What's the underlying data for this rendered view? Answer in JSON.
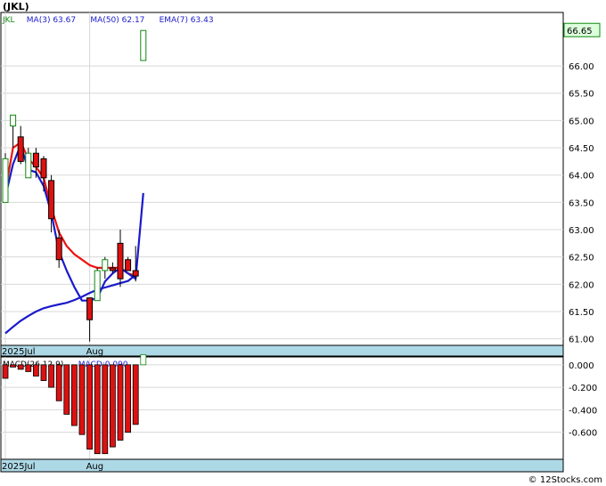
{
  "ticker": "(JKL)",
  "footer": "© 12Stocks.com",
  "colors": {
    "ma_fast": "#ee1111",
    "ma_slow": "#1a1acc",
    "up_candle": "#118811",
    "down_candle": "#dd1111",
    "date_band": "#add8e6",
    "last_price_bg": "#ddffdd"
  },
  "chart_data": [
    {
      "type": "candlestick",
      "legend": [
        {
          "label": "JKL",
          "color": "#118811"
        },
        {
          "label": "MA(3)",
          "value": "63.67",
          "color": "#1a1acc"
        },
        {
          "label": "MA(50)",
          "value": "62.17",
          "color": "#1a1acc"
        },
        {
          "label": "EMA(7)",
          "value": "63.43",
          "color": "#1a1acc"
        }
      ],
      "last_price": "66.65",
      "ylim": [
        60.88,
        66.98
      ],
      "y_ticks": [
        61.0,
        61.5,
        62.0,
        62.5,
        63.0,
        63.5,
        64.0,
        64.5,
        65.0,
        65.5,
        66.0
      ],
      "x_labels": [
        {
          "label": "2025Jul",
          "index": 0
        },
        {
          "label": "Aug",
          "index": 11
        }
      ],
      "candles": [
        {
          "o": 63.5,
          "h": 64.4,
          "l": 63.5,
          "c": 64.3
        },
        {
          "o": 64.9,
          "h": 65.1,
          "l": 64.5,
          "c": 65.1
        },
        {
          "o": 64.7,
          "h": 64.9,
          "l": 64.2,
          "c": 64.25
        },
        {
          "o": 63.95,
          "h": 64.5,
          "l": 63.95,
          "c": 64.4
        },
        {
          "o": 64.4,
          "h": 64.5,
          "l": 63.95,
          "c": 64.15
        },
        {
          "o": 64.3,
          "h": 64.35,
          "l": 63.7,
          "c": 63.95
        },
        {
          "o": 63.9,
          "h": 64.0,
          "l": 62.95,
          "c": 63.2
        },
        {
          "o": 62.85,
          "h": 63.0,
          "l": 62.3,
          "c": 62.45
        },
        {
          "o": null,
          "h": null,
          "l": null,
          "c": null
        },
        {
          "o": null,
          "h": null,
          "l": null,
          "c": null
        },
        {
          "o": null,
          "h": null,
          "l": null,
          "c": null
        },
        {
          "o": 61.75,
          "h": 61.75,
          "l": 60.95,
          "c": 61.35
        },
        {
          "o": 61.7,
          "h": 62.3,
          "l": 61.7,
          "c": 62.25
        },
        {
          "o": 62.25,
          "h": 62.5,
          "l": 62.1,
          "c": 62.45
        },
        {
          "o": 62.3,
          "h": 62.4,
          "l": 62.2,
          "c": 62.25
        },
        {
          "o": 62.75,
          "h": 63.0,
          "l": 61.95,
          "c": 62.1
        },
        {
          "o": 62.45,
          "h": 62.5,
          "l": 62.25,
          "c": 62.25
        },
        {
          "o": 62.25,
          "h": 62.7,
          "l": 62.05,
          "c": 62.15
        },
        {
          "o": 66.1,
          "h": 66.6,
          "l": 66.1,
          "c": 66.65
        }
      ],
      "ema_line": [
        63.7,
        64.5,
        64.6,
        64.3,
        64.15,
        63.95,
        63.4,
        62.95,
        62.7,
        62.55,
        62.45,
        62.35,
        62.3,
        62.3,
        62.3,
        62.3,
        62.2,
        62.15,
        null
      ],
      "ma_short_line": [
        63.6,
        64.2,
        64.55,
        64.1,
        64.05,
        63.8,
        63.3,
        62.6,
        62.25,
        61.95,
        61.7,
        61.7,
        61.75,
        62.05,
        62.2,
        62.3,
        62.2,
        62.1,
        63.67
      ],
      "ma_long_line": [
        61.1,
        61.22,
        61.33,
        61.42,
        61.5,
        61.56,
        61.6,
        61.63,
        61.66,
        61.71,
        61.77,
        61.84,
        61.9,
        61.94,
        61.98,
        62.02,
        62.06,
        62.17,
        null
      ]
    },
    {
      "type": "bar",
      "legend": [
        {
          "label": "MACD(26,12,9)",
          "color": "#000000"
        },
        {
          "label": "MACD:0.090",
          "color": "#1a1acc"
        }
      ],
      "ylim": [
        -0.84,
        0.07
      ],
      "y_ticks": [
        0.0,
        -0.2,
        -0.4,
        -0.6
      ],
      "y_tick_labels": [
        "0.000",
        "-0.200",
        "-0.400",
        "-0.600"
      ],
      "x_labels": [
        {
          "label": "2025Jul",
          "index": 0
        },
        {
          "label": "Aug",
          "index": 11
        }
      ],
      "values": [
        -0.12,
        -0.02,
        -0.04,
        -0.06,
        -0.1,
        -0.14,
        -0.2,
        -0.32,
        -0.44,
        -0.54,
        -0.62,
        -0.75,
        -0.79,
        -0.79,
        -0.73,
        -0.67,
        -0.6,
        -0.53,
        0.09
      ]
    }
  ]
}
